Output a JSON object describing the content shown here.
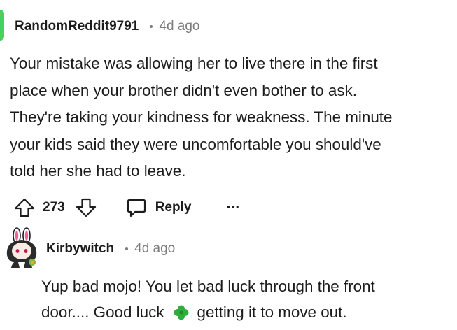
{
  "comments": [
    {
      "username": "RandomReddit9791",
      "time": "4d ago",
      "body_lines": [
        "Your mistake was allowing her to live there in the first",
        "place when your brother didn't even bother to ask.",
        "They're taking your kindness for weakness. The minute",
        "your kids said they were uncomfortable you should've",
        "told her she had to leave."
      ],
      "votes": "273",
      "reply_label": "Reply",
      "more_label": "···",
      "icons": [
        "upvote-arrow-icon",
        "downvote-arrow-icon",
        "reply-bubble-icon",
        "more-dots-icon"
      ],
      "avatar_color": "#46d160"
    },
    {
      "username": "Kirbywitch",
      "time": "4d ago",
      "body_line1": "Yup bad mojo! You let bad luck through the front",
      "body_line2_before": "door.... Good luck",
      "body_emoji": "four-leaf-clover-icon",
      "body_line2_after": "getting it to move out."
    }
  ],
  "colors": {
    "text": "#1c1c1c",
    "meta": "#7c7c7c",
    "clover": "#2fae3a"
  }
}
